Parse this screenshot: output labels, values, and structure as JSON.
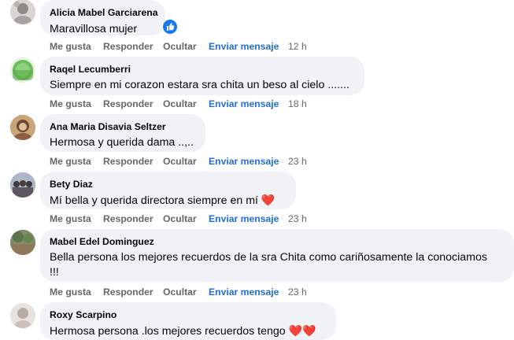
{
  "actions": {
    "like": "Me gusta",
    "reply": "Responder",
    "hide": "Ocultar",
    "message": "Enviar mensaje"
  },
  "colors": {
    "accent": "#216fdb",
    "bubble": "#f0f2f5",
    "muted": "#65676b",
    "heart": "#e41e3f"
  },
  "comments": [
    {
      "author": "Alicia Mabel Garciarena",
      "text": "Maravillosa mujer",
      "time": "12 h",
      "reaction": "like-icon"
    },
    {
      "author": "Raqel Lecumberri",
      "text": "Siempre en mi corazon estara sra chita un beso al cielo .......",
      "time": "18 h"
    },
    {
      "author": "Ana Maria Disavia Seltzer",
      "text": "Hermosa y querida dama ..,..",
      "time": "23 h"
    },
    {
      "author": "Bety Diaz",
      "text": "Mí bella y querida directora siempre en mí",
      "time": "23 h",
      "emoji": "❤️"
    },
    {
      "author": "Mabel Edel Dominguez",
      "text": "Bella persona los mejores recuerdos de la sra Chita como cariñosamente la conociamos",
      "text2": "!!!",
      "time": "23 h"
    },
    {
      "author": "Roxy Scarpino",
      "text": "Hermosa persona .los mejores recuerdos tengo",
      "emoji": "❤️❤️"
    }
  ]
}
